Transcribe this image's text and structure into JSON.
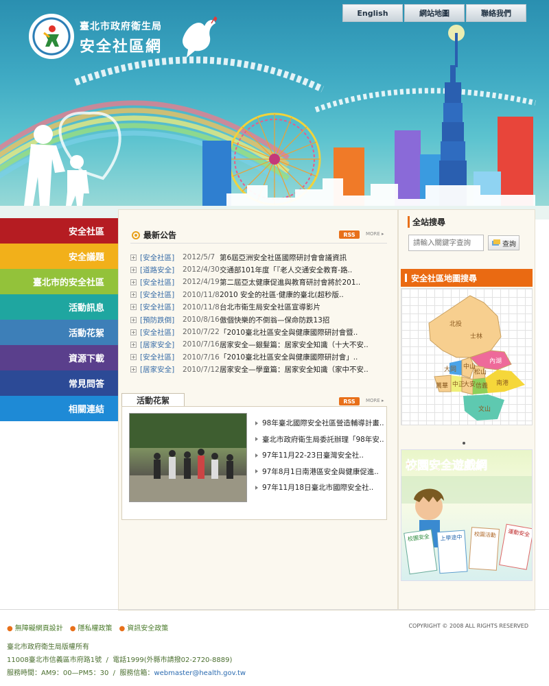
{
  "header": {
    "org": "臺北市政府衛生局",
    "site": "安全社區網",
    "top_links": [
      "English",
      "網站地圖",
      "聯絡我們"
    ]
  },
  "nav": {
    "items": [
      {
        "label": "安全社區",
        "color": "#b51c22"
      },
      {
        "label": "安全議題",
        "color": "#f2b01a"
      },
      {
        "label": "臺北市的安全社區",
        "color": "#93c23a"
      },
      {
        "label": "活動訊息",
        "color": "#1fa6a0"
      },
      {
        "label": "活動花絮",
        "color": "#3d7fb8"
      },
      {
        "label": "資源下載",
        "color": "#5a3f8c"
      },
      {
        "label": "常見問答",
        "color": "#2c4a96"
      },
      {
        "label": "相關連結",
        "color": "#1e8ad6"
      }
    ]
  },
  "news": {
    "title": "最新公告",
    "rss": "RSS",
    "more": "MORE ▸",
    "items": [
      {
        "cat": "[安全社區]",
        "date": "2012/5/7",
        "title": "第6屆亞洲安全社區國際研討會會議資訊"
      },
      {
        "cat": "[道路安全]",
        "date": "2012/4/30",
        "title": "交通部101年度「『老人交通安全教育-路.."
      },
      {
        "cat": "[安全社區]",
        "date": "2012/4/19",
        "title": "第二屆亞太健康促進與教育研討會將於201.."
      },
      {
        "cat": "[安全社區]",
        "date": "2010/11/8",
        "title": "2010 安全的社區‧健康的臺北(超秒版.."
      },
      {
        "cat": "[安全社區]",
        "date": "2010/11/8",
        "title": "台北市衛生局安全社區宣導影片"
      },
      {
        "cat": "[預防跌倒]",
        "date": "2010/8/16",
        "title": "傲個快樂的不倒翁—保命防跌13招"
      },
      {
        "cat": "[安全社區]",
        "date": "2010/7/22",
        "title": "「2010臺北社區安全與健康國際研討會暨.."
      },
      {
        "cat": "[居家安全]",
        "date": "2010/7/16",
        "title": "居家安全—銀髮篇：居家安全知識（十大不安.."
      },
      {
        "cat": "[安全社區]",
        "date": "2010/7/16",
        "title": "「2010臺北社區安全與健康國際研討會」.."
      },
      {
        "cat": "[居家安全]",
        "date": "2010/7/12",
        "title": "居家安全—學童篇：居家安全知識（家中不安.."
      }
    ]
  },
  "activities": {
    "title": "活動花絮",
    "rss": "RSS",
    "more": "MORE ▸",
    "items": [
      "98年臺北國際安全社區營造輔導計畫..",
      "臺北市政府衛生局委託辦理「98年安..",
      "97年11月22-23日臺灣安全社..",
      "97年8月1日南港區安全與健康促進..",
      "97年11月18日臺北市國際安全社.."
    ]
  },
  "search": {
    "title": "全站搜尋",
    "placeholder": "請輸入關鍵字查詢",
    "button": "查詢"
  },
  "map": {
    "title": "安全社區地圖搜尋",
    "districts": [
      "北投",
      "士林",
      "內湖",
      "大同",
      "中山",
      "松山",
      "中正",
      "大安",
      "信義",
      "南港",
      "萬華",
      "文山"
    ]
  },
  "campus": {
    "title": "校園安全遊戲網",
    "book1": "校園安全",
    "book2": "上學途中",
    "book3": "校園活動",
    "book4": "運動安全"
  },
  "footer": {
    "links": [
      "無障礙網頁設計",
      "隱私權政策",
      "資訊安全政策"
    ],
    "copyright": "COPYRIGHT © 2008 ALL RIGHTS RESERVED",
    "owner": "臺北市政府衛生局版權所有",
    "address": "11008臺北市信義區市府路1號",
    "phone": "電話1999(外縣市請撥02-2720-8889)",
    "hours": "服務時間：AM9：00—PM5：30",
    "mail_label": "服務信箱：",
    "mail": "webmaster@health.gov.tw"
  }
}
